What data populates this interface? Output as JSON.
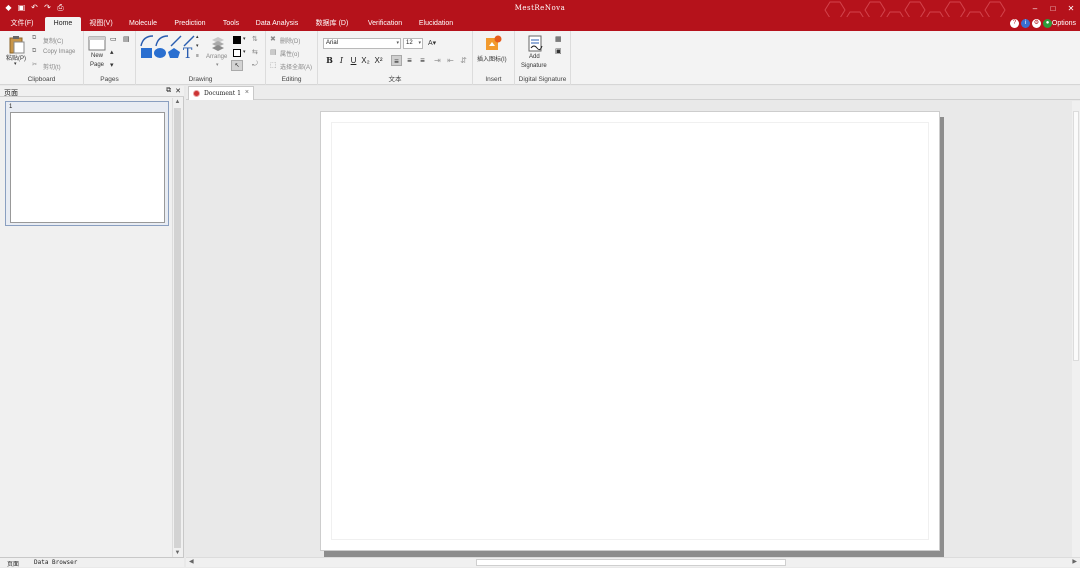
{
  "app_title": "MestReNova",
  "quick_access": [
    "save-icon",
    "undo-icon",
    "redo-icon",
    "print-icon"
  ],
  "tabs": [
    {
      "label": "文件(F)",
      "active": false
    },
    {
      "label": "Home",
      "active": true
    },
    {
      "label": "视图(V)",
      "active": false
    },
    {
      "label": "Molecule",
      "active": false
    },
    {
      "label": "Prediction",
      "active": false
    },
    {
      "label": "Tools",
      "active": false
    },
    {
      "label": "Data Analysis",
      "active": false
    },
    {
      "label": "数据库 (D)",
      "active": false
    },
    {
      "label": "Verification",
      "active": false
    },
    {
      "label": "Elucidation",
      "active": false
    }
  ],
  "options_label": "Options",
  "ribbon": {
    "clipboard": {
      "paste": "粘贴(P)",
      "copy": "复制(C)",
      "copy_image": "Copy Image",
      "cut": "剪切(t)",
      "label": "Clipboard"
    },
    "pages": {
      "new_page_1": "New",
      "new_page_2": "Page",
      "label": "Pages"
    },
    "drawing": {
      "arrange": "Arrange",
      "label": "Drawing"
    },
    "editing": {
      "delete": "删除(D)",
      "properties": "属性(o)",
      "select_all": "选择全部(A)",
      "label": "Editing"
    },
    "text": {
      "font": "Arial",
      "size": "12",
      "label": "文本"
    },
    "insert": {
      "insert_image": "插入图标(I)",
      "label": "Insert"
    },
    "signature": {
      "add_1": "Add",
      "add_2": "Signature",
      "label": "Digital Signature"
    }
  },
  "left_panel": {
    "title": "页面",
    "thumb_number": "1"
  },
  "bottom_tabs": [
    "页面",
    "Data Browser"
  ],
  "document_tab": "Document 1",
  "colors": {
    "brand": "#b5121b",
    "ribbon_bg": "#f3f3f3",
    "canvas_bg": "#e9e9e9"
  }
}
